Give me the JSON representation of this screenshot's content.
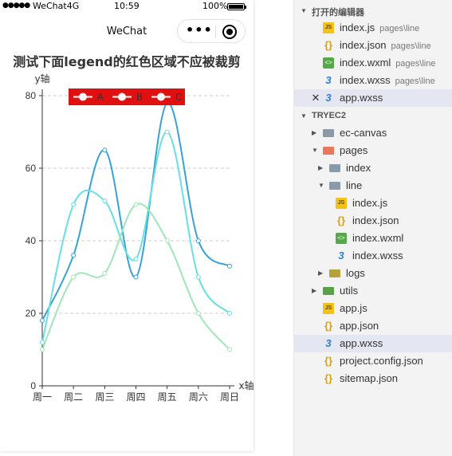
{
  "statusbar": {
    "signal": "●●●●●",
    "carrier": "WeChat4G",
    "time": "10:59",
    "battery": "100%"
  },
  "navbar": {
    "title": "WeChat",
    "menu_icon": "more-dots-icon",
    "close_icon": "record-close-icon"
  },
  "chart_title": "测试下面legend的红色区域不应被裁剪",
  "chart_data": {
    "type": "line",
    "title": "测试下面legend的红色区域不应被裁剪",
    "xlabel": "x轴",
    "ylabel": "y轴",
    "categories": [
      "周一",
      "周二",
      "周三",
      "周四",
      "周五",
      "周六",
      "周日"
    ],
    "ylim": [
      0,
      80
    ],
    "yticks": [
      0,
      20,
      40,
      60,
      80
    ],
    "smooth": true,
    "grid": "dashed horizontal",
    "legend_placement": "top",
    "legend_background": "#e01010",
    "series": [
      {
        "name": "A",
        "values": [
          18,
          36,
          65,
          30,
          78,
          40,
          33
        ],
        "color": "#37a2da"
      },
      {
        "name": "B",
        "values": [
          12,
          50,
          51,
          35,
          70,
          30,
          20
        ],
        "color": "#67e0e3"
      },
      {
        "name": "C",
        "values": [
          10,
          30,
          31,
          50,
          40,
          20,
          10
        ],
        "color": "#9fe6b8"
      }
    ]
  },
  "explorer": {
    "open_editors_header": "打开的编辑器",
    "open_editors": [
      {
        "name": "index.js",
        "path": "pages\\line",
        "icon": "js-file-icon"
      },
      {
        "name": "index.json",
        "path": "pages\\line",
        "icon": "json-file-icon"
      },
      {
        "name": "index.wxml",
        "path": "pages\\line",
        "icon": "wxml-file-icon"
      },
      {
        "name": "index.wxss",
        "path": "pages\\line",
        "icon": "wxss-file-icon"
      },
      {
        "name": "app.wxss",
        "path": "",
        "icon": "close-icon"
      }
    ],
    "project_header": "TRYEC2",
    "tree": [
      {
        "name": "ec-canvas",
        "icon": "folder-icon"
      },
      {
        "name": "pages",
        "icon": "folder-open-icon"
      },
      {
        "name": "index",
        "icon": "folder-icon"
      },
      {
        "name": "line",
        "icon": "folder-open-icon"
      },
      {
        "name": "index.js",
        "icon": "js-file-icon"
      },
      {
        "name": "index.json",
        "icon": "json-file-icon"
      },
      {
        "name": "index.wxml",
        "icon": "wxml-file-icon"
      },
      {
        "name": "index.wxss",
        "icon": "wxss-file-icon"
      },
      {
        "name": "logs",
        "icon": "folder-icon"
      },
      {
        "name": "utils",
        "icon": "folder-icon"
      },
      {
        "name": "app.js",
        "icon": "js-file-icon"
      },
      {
        "name": "app.json",
        "icon": "json-file-icon"
      },
      {
        "name": "app.wxss",
        "icon": "wxss-file-icon"
      },
      {
        "name": "project.config.json",
        "icon": "json-file-icon"
      },
      {
        "name": "sitemap.json",
        "icon": "json-file-icon"
      }
    ]
  }
}
